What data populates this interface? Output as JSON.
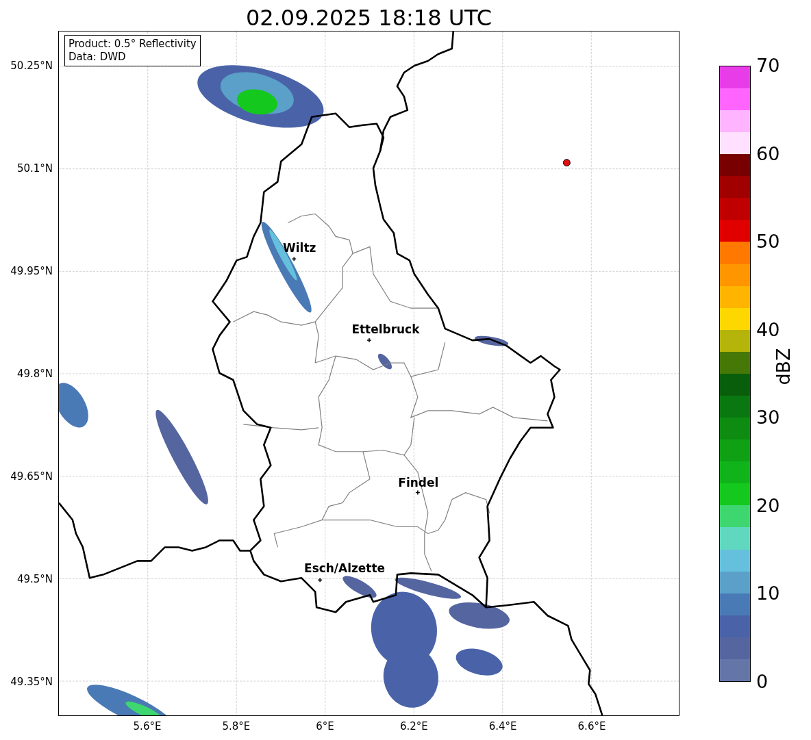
{
  "title": "02.09.2025 18:18 UTC",
  "info_box": {
    "lines": [
      "Product: 0.5° Reflectivity",
      "Data: DWD"
    ]
  },
  "axes": {
    "lat_ticks": [
      "50.25°N",
      "50.1°N",
      "49.95°N",
      "49.8°N",
      "49.65°N",
      "49.5°N",
      "49.35°N"
    ],
    "lon_ticks": [
      "5.6°E",
      "5.8°E",
      "6°E",
      "6.2°E",
      "6.4°E",
      "6.6°E"
    ]
  },
  "cities": [
    {
      "name": "Wiltz"
    },
    {
      "name": "Ettelbruck"
    },
    {
      "name": "Findel"
    },
    {
      "name": "Esch/Alzette"
    }
  ],
  "colorbar": {
    "label": "dBZ",
    "ticks": [
      "70",
      "60",
      "50",
      "40",
      "30",
      "20",
      "10",
      "0"
    ],
    "segments": [
      {
        "color": "#6475a8"
      },
      {
        "color": "#5565a0"
      },
      {
        "color": "#4a63a8"
      },
      {
        "color": "#4a7ab5"
      },
      {
        "color": "#5aa0c8"
      },
      {
        "color": "#64c0dc"
      },
      {
        "color": "#60d8c0"
      },
      {
        "color": "#3ed66e"
      },
      {
        "color": "#14c81e"
      },
      {
        "color": "#10b41a"
      },
      {
        "color": "#10a014"
      },
      {
        "color": "#0e8c12"
      },
      {
        "color": "#0a7810"
      },
      {
        "color": "#085e0a"
      },
      {
        "color": "#467808"
      },
      {
        "color": "#b4b40a"
      },
      {
        "color": "#ffd700"
      },
      {
        "color": "#ffb400"
      },
      {
        "color": "#ff9600"
      },
      {
        "color": "#ff7800"
      },
      {
        "color": "#e00000"
      },
      {
        "color": "#c00000"
      },
      {
        "color": "#a00000"
      },
      {
        "color": "#780000"
      },
      {
        "color": "#ffe0ff"
      },
      {
        "color": "#ffb4ff"
      },
      {
        "color": "#ff64ff"
      },
      {
        "color": "#e83ce8"
      }
    ]
  }
}
